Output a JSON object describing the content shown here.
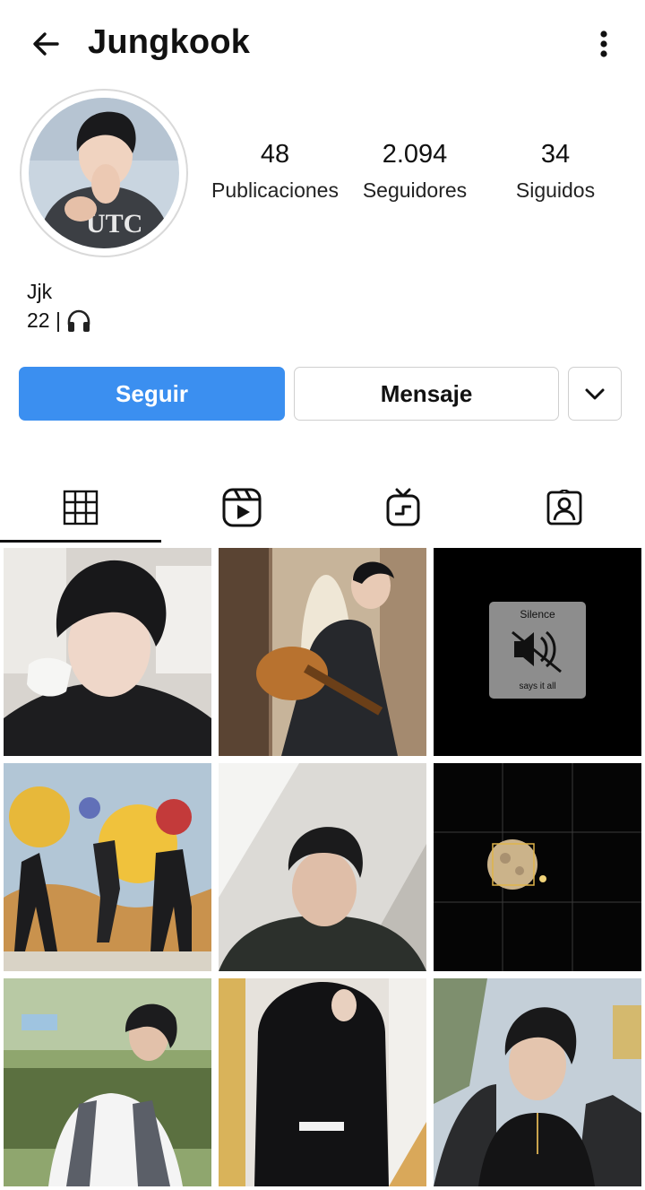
{
  "header": {
    "title": "Jungkook",
    "back_icon": "arrow-left-icon",
    "more_icon": "more-vertical-icon"
  },
  "profile": {
    "avatar_icon": "profile-photo",
    "stats": [
      {
        "value": "48",
        "label": "Publicaciones"
      },
      {
        "value": "2.094",
        "label": "Seguidores"
      },
      {
        "value": "34",
        "label": "Siguidos"
      }
    ],
    "bio_name": "Jjk",
    "bio_line": "22 |",
    "bio_emoji": "headphones-icon"
  },
  "actions": {
    "follow_label": "Seguir",
    "message_label": "Mensaje",
    "dropdown_icon": "chevron-down-icon"
  },
  "tabs": [
    {
      "name": "grid",
      "icon": "grid-icon",
      "active": true
    },
    {
      "name": "reels",
      "icon": "reels-icon",
      "active": false
    },
    {
      "name": "igtv",
      "icon": "igtv-icon",
      "active": false
    },
    {
      "name": "tagged",
      "icon": "tagged-user-icon",
      "active": false
    }
  ],
  "posts": {
    "silence_card": {
      "title": "Silence",
      "subtitle": "says it all"
    }
  },
  "colors": {
    "accent": "#3b8ff0",
    "text": "#111111",
    "border": "#cfcfcf"
  }
}
